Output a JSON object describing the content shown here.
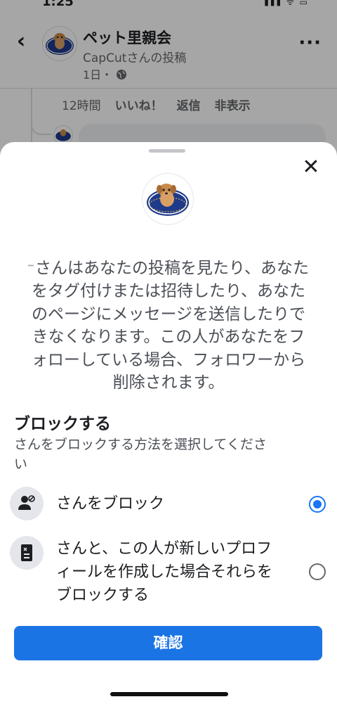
{
  "status_bar": {
    "time": "1:25",
    "signal": "▮▮▮ ᯤ ▭"
  },
  "header": {
    "back_glyph": "‹",
    "group_name": "ペット里親会",
    "post_author": "CapCutさんの投稿",
    "post_meta": "1日・",
    "more_glyph": "···"
  },
  "comment": {
    "time": "12時間",
    "like": "いいね！",
    "reply": "返信",
    "hide": "非表示"
  },
  "sheet": {
    "close_glyph": "✕",
    "description_lines": [
      "さんはあなたの投稿を見たり、あなた",
      "をタグ付けまたは招待したり、あなた",
      "のページにメッセージを送信したりで",
      "きなくなります。この人があなたをフ",
      "ォローしている場合、フォロワーから",
      "削除されます。"
    ],
    "section_title": "ブロックする",
    "section_sub_lines": [
      "さんをブロックする方法を選択してくださ",
      "い"
    ],
    "options": [
      {
        "label_lines": [
          "さんをブロック"
        ],
        "selected": true,
        "icon": "person-block-icon"
      },
      {
        "label_lines": [
          "さんと、この人が新しいプロフ",
          "ィールを作成した場合それらを",
          "ブロックする"
        ],
        "selected": false,
        "icon": "profile-block-icon"
      }
    ],
    "confirm_label": "確認"
  },
  "colors": {
    "accent": "#1b74e4",
    "radio": "#1877f2"
  }
}
